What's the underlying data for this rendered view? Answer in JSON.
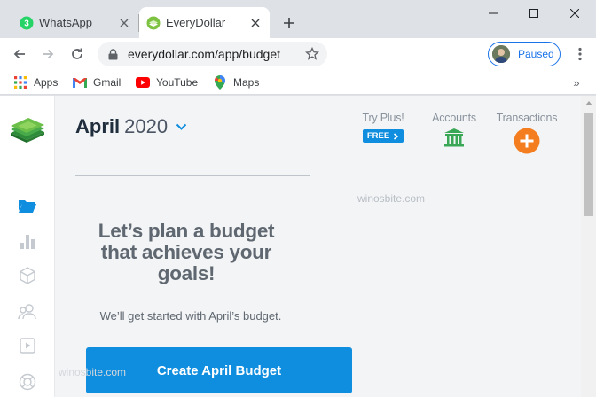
{
  "browser": {
    "tabs": [
      {
        "title": "WhatsApp",
        "favicon": "whatsapp-icon",
        "badge": "3",
        "active": false
      },
      {
        "title": "EveryDollar",
        "favicon": "everydollar-icon",
        "active": true
      }
    ],
    "address": "everydollar.com/app/budget",
    "profile_label": "Paused",
    "bookmarks": [
      {
        "label": "Apps",
        "icon": "apps-grid-icon"
      },
      {
        "label": "Gmail",
        "icon": "gmail-icon"
      },
      {
        "label": "YouTube",
        "icon": "youtube-icon"
      },
      {
        "label": "Maps",
        "icon": "maps-pin-icon"
      }
    ],
    "bookmarks_more": "»"
  },
  "page": {
    "month": "April",
    "year": "2020",
    "topnav": {
      "try_plus": "Try Plus!",
      "free_badge": "FREE",
      "accounts": "Accounts",
      "transactions": "Transactions"
    },
    "headline": "Let’s plan a budget that achieves your goals!",
    "subline": "We’ll get started with April’s budget.",
    "cta": "Create April Budget",
    "watermark_1": "winosbite.com",
    "watermark_2": "winosbite.com"
  },
  "colors": {
    "brand_blue": "#0f8dde",
    "brand_green": "#3aa757",
    "orange": "#f47e1f",
    "chrome_blue": "#1a73e8"
  }
}
